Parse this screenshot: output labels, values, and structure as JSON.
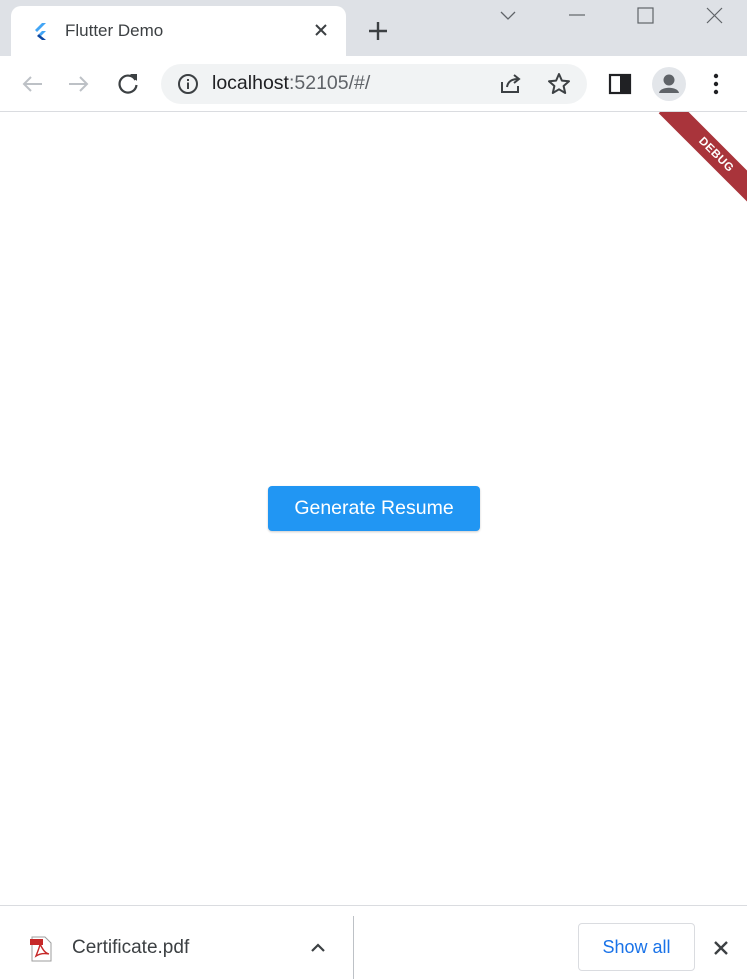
{
  "browser": {
    "tab": {
      "title": "Flutter Demo",
      "favicon": "flutter-logo-icon"
    },
    "url": {
      "host": "localhost",
      "rest": ":52105/#/"
    },
    "colors": {
      "tabstrip": "#dee1e6",
      "omnibox": "#f1f3f4",
      "accent": "#1a73e8"
    }
  },
  "app": {
    "debug_banner": "DEBUG",
    "generate_button_label": "Generate Resume",
    "colors": {
      "button": "#2196f3",
      "debug_banner": "#a9343b"
    }
  },
  "download_bar": {
    "item": {
      "filename": "Certificate.pdf",
      "icon": "pdf-file-icon"
    },
    "show_all_label": "Show all"
  }
}
